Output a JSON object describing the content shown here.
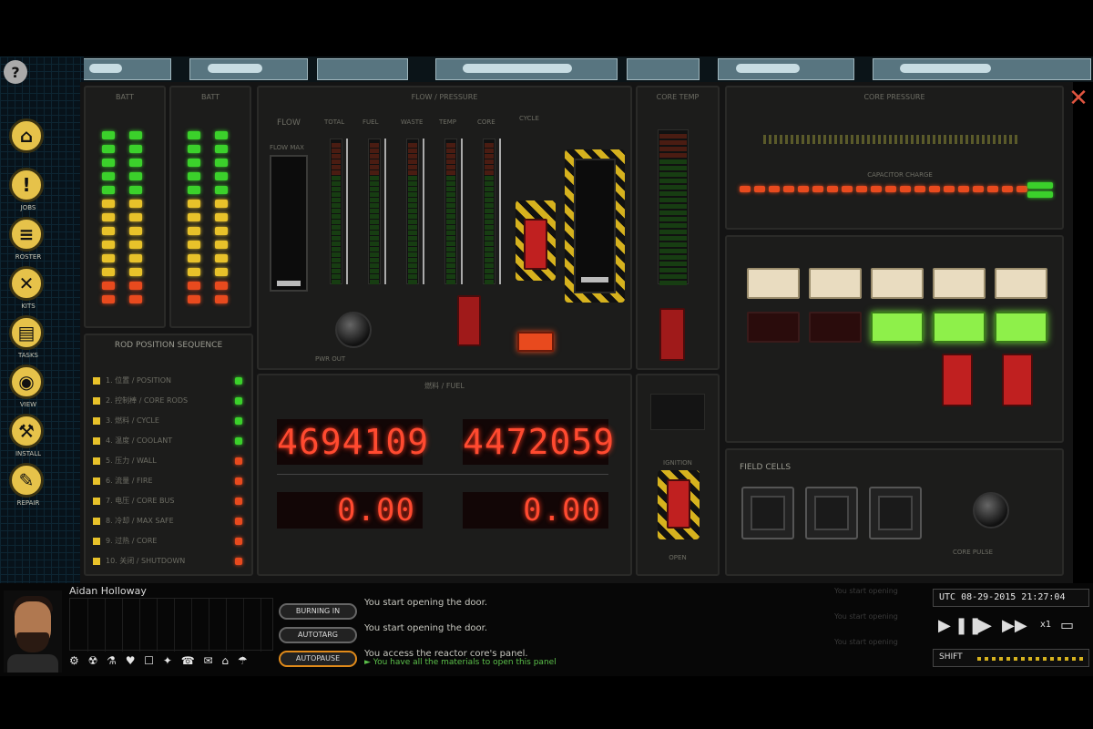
{
  "header": {
    "help_icon": "?",
    "close_icon": "✕"
  },
  "sidebar": {
    "items": [
      {
        "icon": "home-icon",
        "glyph": "⌂",
        "label": ""
      },
      {
        "icon": "alert-icon",
        "glyph": "!",
        "label": "JOBS"
      },
      {
        "icon": "roster-icon",
        "glyph": "≡",
        "label": "ROSTER"
      },
      {
        "icon": "tools-icon",
        "glyph": "✕",
        "label": "KITS"
      },
      {
        "icon": "clipboard-icon",
        "glyph": "▤",
        "label": "TASKS"
      },
      {
        "icon": "eye-icon",
        "glyph": "◉",
        "label": "VIEW"
      },
      {
        "icon": "hammer-icon",
        "glyph": "⚒",
        "label": "INSTALL"
      },
      {
        "icon": "wrench-icon",
        "glyph": "✎",
        "label": "REPAIR"
      }
    ]
  },
  "panels": {
    "batt1": {
      "title": "BATT"
    },
    "batt2": {
      "title": "BATT"
    },
    "flow_title": "FLOW / PRESSURE",
    "flow_label": "FLOW",
    "flow_scale_label": "FLOW MAX",
    "gauge_labels": [
      "TOTAL",
      "FUEL",
      "WASTE",
      "TEMP",
      "CORE"
    ],
    "cycle_label": "CYCLE",
    "power_label": "PWR OUT",
    "position_title": "ROD POSITION SEQUENCE",
    "sequence_items": [
      "1. 位置 / POSITION",
      "2. 控制棒 / CORE RODS",
      "3. 燃料 / CYCLE",
      "4. 温度 / COOLANT",
      "5. 压力 / WALL",
      "6. 流量 / FIRE",
      "7. 电压 / CORE BUS",
      "8. 冷却 / MAX SAFE",
      "9. 过热 / CORE",
      "10. 关闭 / SHUTDOWN"
    ],
    "fuel_title": "燃料 / FUEL",
    "fuel_readout_1": "4694109",
    "fuel_readout_2": "4472059",
    "rate_readout_1": "0.00",
    "rate_readout_2": "0.00",
    "core_temp_title": "CORE TEMP",
    "core_pressure_title": "CORE PRESSURE",
    "capacitor_title": "CAPACITOR CHARGE",
    "field_title": "FIELD CELLS",
    "core_pulse_label": "CORE PULSE",
    "ignition_label": "IGNITION",
    "open_label": "OPEN"
  },
  "hud": {
    "character_name": "Aidan Holloway",
    "buttons": [
      "BURNING IN",
      "AUTOTARG",
      "AUTOPAUSE"
    ],
    "log": [
      "You start opening the door.",
      "You start opening the door.",
      "You access the reactor core's panel."
    ],
    "log_hint": "► You have all the materials to open this panel",
    "faded_log": [
      "You start opening",
      "You start opening",
      "You start opening"
    ],
    "clock": "UTC 08-29-2015 21:27:04",
    "speed_label": "x1",
    "shift_label": "SHIFT"
  },
  "colors": {
    "led_green": "#3bd12b",
    "led_yellow": "#e8c22a",
    "led_red": "#e84a1e",
    "readout": "#ff4a30"
  }
}
